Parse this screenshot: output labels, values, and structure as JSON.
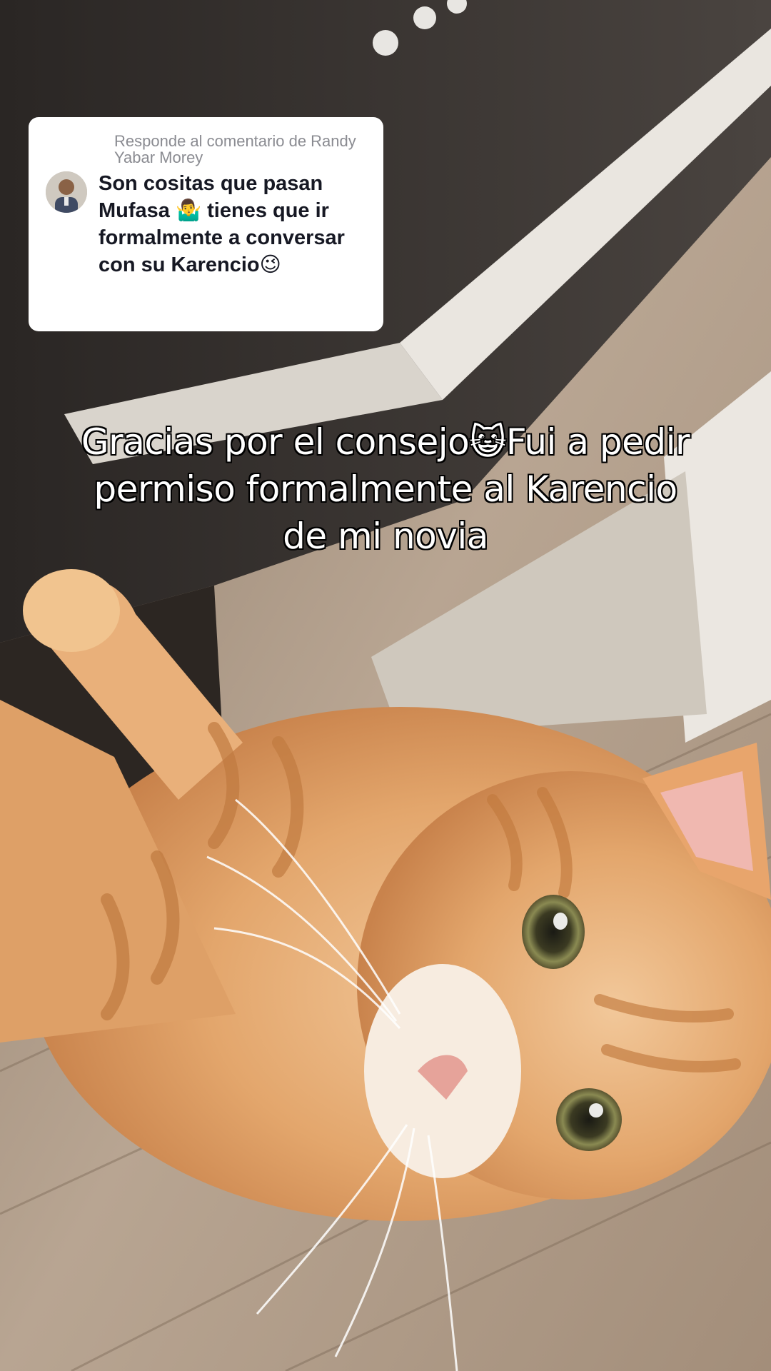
{
  "reply": {
    "header": "Responde al comentario de Randy Yabar Morey",
    "comment": "Son cositas que pasan Mufasa 🤷‍♂️ tienes que ir formalmente a conversar con su Karencio😉"
  },
  "caption": {
    "text": "Gracias por el consejo😺Fui a pedir permiso formalmente al Karencio de mi novia"
  },
  "colors": {
    "card_background": "#ffffff",
    "header_text": "#8a8b91",
    "comment_text": "#161823",
    "caption_text": "#ffffff",
    "caption_outline": "#000000"
  }
}
